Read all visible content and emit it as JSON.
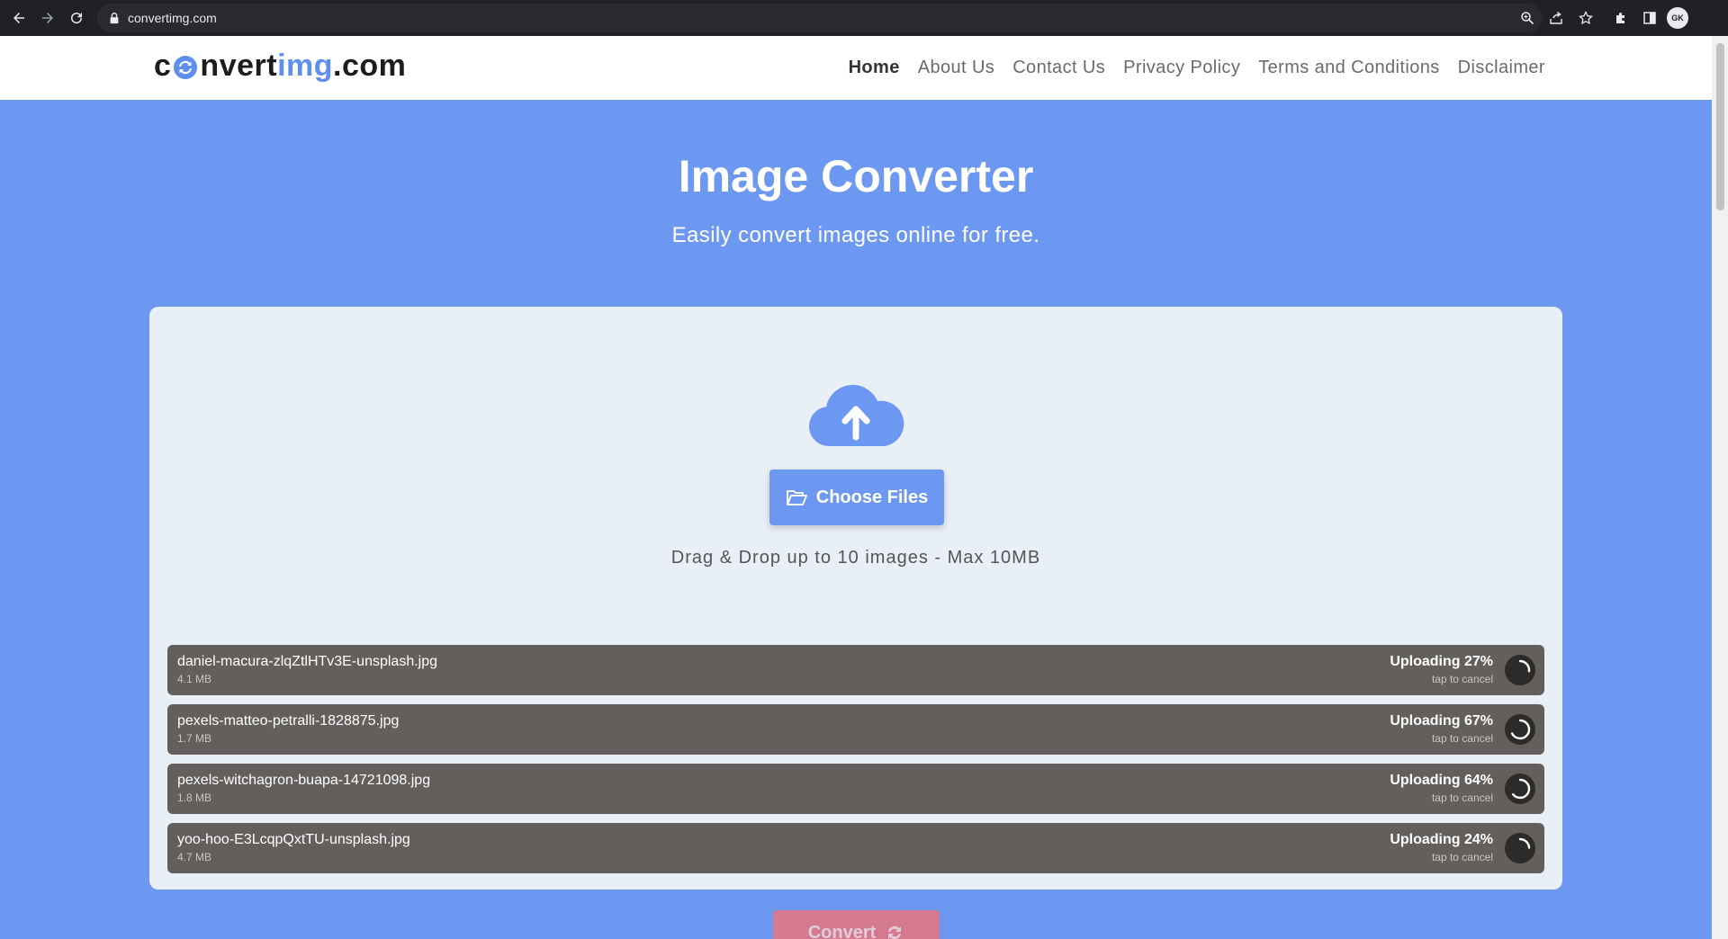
{
  "browser": {
    "url": "convertimg.com",
    "profile_initials": "GK",
    "icons": [
      "back-icon",
      "forward-icon",
      "reload-icon",
      "lock-icon",
      "zoom-icon",
      "share-icon",
      "bookmark-star-icon",
      "extensions-icon",
      "side-panel-icon"
    ]
  },
  "header": {
    "logo": {
      "c": "c",
      "rest": "nvert",
      "img": "img",
      "dotcom": ".com"
    },
    "nav": [
      {
        "label": "Home",
        "active": true
      },
      {
        "label": "About Us"
      },
      {
        "label": "Contact Us"
      },
      {
        "label": "Privacy Policy"
      },
      {
        "label": "Terms and Conditions"
      },
      {
        "label": "Disclaimer"
      }
    ]
  },
  "hero": {
    "title": "Image Converter",
    "subtitle": "Easily convert images online for free."
  },
  "upload": {
    "button_label": "Choose Files",
    "hint": "Drag & Drop up to 10 images - Max 10MB",
    "files": [
      {
        "name": "daniel-macura-zlqZtlHTv3E-unsplash.jpg",
        "size": "4.1 MB",
        "status": "Uploading 27%",
        "progress": 0.27,
        "cancel": "tap to cancel"
      },
      {
        "name": "pexels-matteo-petralli-1828875.jpg",
        "size": "1.7 MB",
        "status": "Uploading 67%",
        "progress": 0.67,
        "cancel": "tap to cancel"
      },
      {
        "name": "pexels-witchagron-buapa-14721098.jpg",
        "size": "1.8 MB",
        "status": "Uploading 64%",
        "progress": 0.64,
        "cancel": "tap to cancel"
      },
      {
        "name": "yoo-hoo-E3LcqpQxtTU-unsplash.jpg",
        "size": "4.7 MB",
        "status": "Uploading 24%",
        "progress": 0.24,
        "cancel": "tap to cancel"
      }
    ]
  },
  "convert": {
    "label": "Convert"
  },
  "colors": {
    "brand": "#6d98f1",
    "logo_accent": "#5d8ef0",
    "file_row": "#635f5c",
    "convert": "#e8747f"
  }
}
